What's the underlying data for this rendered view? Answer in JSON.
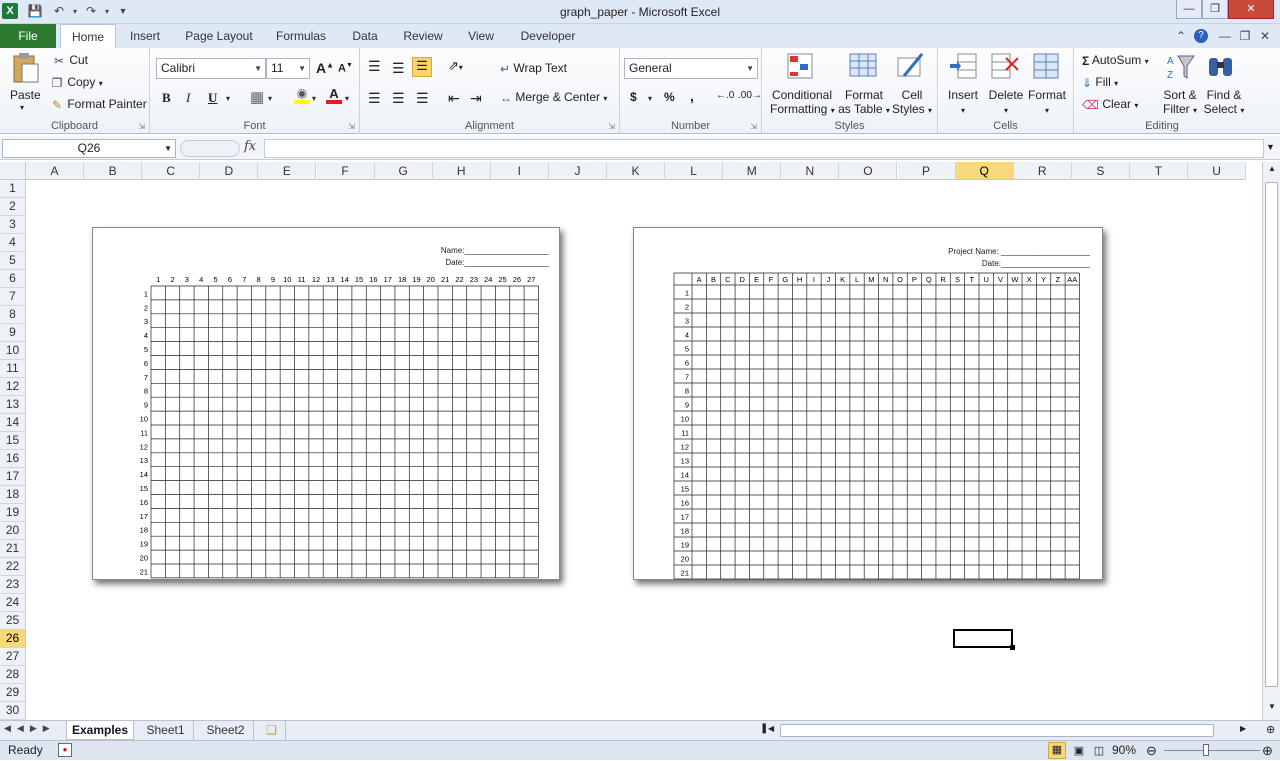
{
  "window": {
    "title": "graph_paper - Microsoft Excel",
    "app_icon": "X"
  },
  "qat": [
    "save-icon",
    "undo-icon",
    "redo-icon",
    "customize-icon"
  ],
  "tabs": [
    "File",
    "Home",
    "Insert",
    "Page Layout",
    "Formulas",
    "Data",
    "Review",
    "View",
    "Developer"
  ],
  "clipboard": {
    "paste": "Paste",
    "cut": "Cut",
    "copy": "Copy",
    "painter": "Format Painter",
    "label": "Clipboard"
  },
  "font": {
    "name": "Calibri",
    "size": "11",
    "bold": "B",
    "italic": "I",
    "underline": "U",
    "label": "Font"
  },
  "alignment": {
    "wrap": "Wrap Text",
    "merge": "Merge & Center",
    "label": "Alignment"
  },
  "number": {
    "format": "General",
    "currency": "$",
    "percent": "%",
    "comma": ",",
    "label": "Number"
  },
  "styles": {
    "conditional_1": "Conditional",
    "conditional_2": "Formatting",
    "format_table_1": "Format",
    "format_table_2": "as Table",
    "cell_styles_1": "Cell",
    "cell_styles_2": "Styles",
    "label": "Styles"
  },
  "cells": {
    "insert": "Insert",
    "delete": "Delete",
    "format": "Format",
    "label": "Cells"
  },
  "editing": {
    "autosum": "AutoSum",
    "fill": "Fill",
    "clear": "Clear",
    "sort_1": "Sort &",
    "sort_2": "Filter",
    "find_1": "Find &",
    "find_2": "Select",
    "label": "Editing"
  },
  "formula_bar": {
    "name_box": "Q26",
    "fx": "fx",
    "value": ""
  },
  "columns": [
    "A",
    "B",
    "C",
    "D",
    "E",
    "F",
    "G",
    "H",
    "I",
    "J",
    "K",
    "L",
    "M",
    "N",
    "O",
    "P",
    "Q",
    "R",
    "S",
    "T",
    "U"
  ],
  "selected_column": "Q",
  "rows": [
    "1",
    "2",
    "3",
    "4",
    "5",
    "6",
    "7",
    "8",
    "9",
    "10",
    "11",
    "12",
    "13",
    "14",
    "15",
    "16",
    "17",
    "18",
    "19",
    "20",
    "21",
    "22",
    "23",
    "24",
    "25",
    "26",
    "27",
    "28",
    "29",
    "30"
  ],
  "selected_row": "26",
  "paper_left": {
    "name_label": "Name:___________________",
    "date_label": "Date:___________________",
    "col_numbers": [
      "1",
      "2",
      "3",
      "4",
      "5",
      "6",
      "7",
      "8",
      "9",
      "10",
      "11",
      "12",
      "13",
      "14",
      "15",
      "16",
      "17",
      "18",
      "19",
      "20",
      "21",
      "22",
      "23",
      "24",
      "25",
      "26",
      "27"
    ],
    "row_numbers": [
      "1",
      "2",
      "3",
      "4",
      "5",
      "6",
      "7",
      "8",
      "9",
      "10",
      "11",
      "12",
      "13",
      "14",
      "15",
      "16",
      "17",
      "18",
      "19",
      "20",
      "21"
    ]
  },
  "paper_right": {
    "name_label": "Project Name: ____________________",
    "date_label": "Date:____________________",
    "col_letters": [
      "A",
      "B",
      "C",
      "D",
      "E",
      "F",
      "G",
      "H",
      "I",
      "J",
      "K",
      "L",
      "M",
      "N",
      "O",
      "P",
      "Q",
      "R",
      "S",
      "T",
      "U",
      "V",
      "W",
      "X",
      "Y",
      "Z",
      "AA"
    ],
    "row_numbers": [
      "1",
      "2",
      "3",
      "4",
      "5",
      "6",
      "7",
      "8",
      "9",
      "10",
      "11",
      "12",
      "13",
      "14",
      "15",
      "16",
      "17",
      "18",
      "19",
      "20",
      "21"
    ]
  },
  "sheets": [
    "Examples",
    "Sheet1",
    "Sheet2"
  ],
  "active_sheet": "Examples",
  "status": {
    "ready": "Ready",
    "zoom": "90%"
  },
  "colors": {
    "file_tab": "#2c7a2f",
    "selected_header": "#f9d77c",
    "close": "#c94a3a"
  }
}
